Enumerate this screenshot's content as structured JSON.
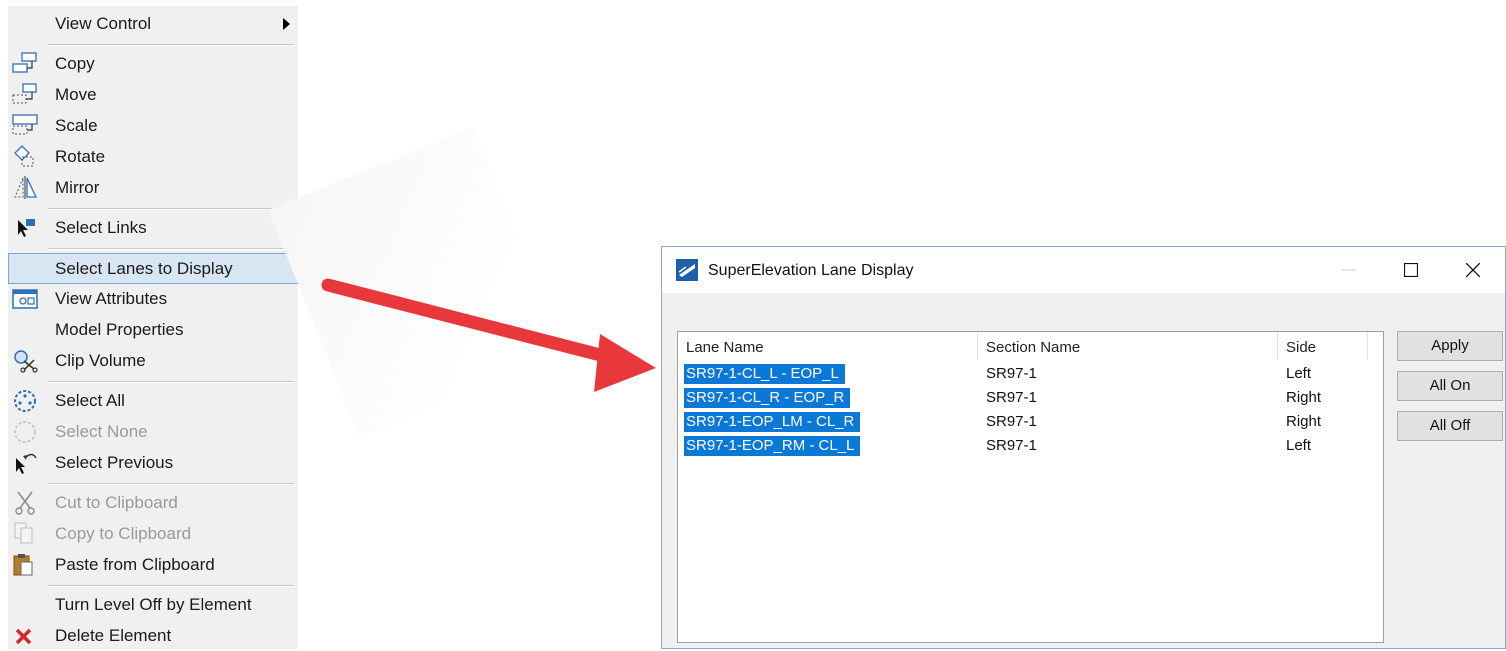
{
  "context_menu": {
    "items": [
      {
        "label": "View Control",
        "icon": "none",
        "submenu": true,
        "disabled": false
      },
      {
        "label": "Copy",
        "icon": "copy-icon",
        "submenu": false,
        "disabled": false
      },
      {
        "label": "Move",
        "icon": "move-icon",
        "submenu": false,
        "disabled": false
      },
      {
        "label": "Scale",
        "icon": "scale-icon",
        "submenu": false,
        "disabled": false
      },
      {
        "label": "Rotate",
        "icon": "rotate-icon",
        "submenu": false,
        "disabled": false
      },
      {
        "label": "Mirror",
        "icon": "mirror-icon",
        "submenu": false,
        "disabled": false
      },
      {
        "label": "Select Links",
        "icon": "select-links-icon",
        "submenu": true,
        "disabled": false
      },
      {
        "label": "Select Lanes to Display",
        "icon": "none",
        "submenu": false,
        "disabled": false,
        "highlighted": true
      },
      {
        "label": "View Attributes",
        "icon": "view-attributes-icon",
        "submenu": false,
        "disabled": false
      },
      {
        "label": "Model Properties",
        "icon": "none",
        "submenu": false,
        "disabled": false
      },
      {
        "label": "Clip Volume",
        "icon": "clip-volume-icon",
        "submenu": false,
        "disabled": false
      },
      {
        "label": "Select All",
        "icon": "select-all-icon",
        "submenu": false,
        "disabled": false
      },
      {
        "label": "Select None",
        "icon": "select-none-icon",
        "submenu": false,
        "disabled": true
      },
      {
        "label": "Select Previous",
        "icon": "select-previous-icon",
        "submenu": false,
        "disabled": false
      },
      {
        "label": "Cut to Clipboard",
        "icon": "scissors-icon",
        "submenu": false,
        "disabled": true
      },
      {
        "label": "Copy to Clipboard",
        "icon": "copy-clipboard-icon",
        "submenu": false,
        "disabled": true
      },
      {
        "label": "Paste from Clipboard",
        "icon": "paste-icon",
        "submenu": false,
        "disabled": false
      },
      {
        "label": "Turn Level Off by Element",
        "icon": "none",
        "submenu": false,
        "disabled": false
      },
      {
        "label": "Delete Element",
        "icon": "delete-x-icon",
        "submenu": false,
        "disabled": false
      }
    ]
  },
  "arrow": {
    "color": "#e8383b",
    "icon": "arrow-icon"
  },
  "dialog": {
    "title": "SuperElevation Lane Display",
    "icon": "superelevation-app-icon",
    "columns": [
      "Lane Name",
      "Section Name",
      "Side"
    ],
    "rows": [
      {
        "lane": "SR97-1-CL_L - EOP_L",
        "section": "SR97-1",
        "side": "Left",
        "selected": true
      },
      {
        "lane": "SR97-1-CL_R - EOP_R",
        "section": "SR97-1",
        "side": "Right",
        "selected": true
      },
      {
        "lane": "SR97-1-EOP_LM - CL_R",
        "section": "SR97-1",
        "side": "Right",
        "selected": true
      },
      {
        "lane": "SR97-1-EOP_RM - CL_L",
        "section": "SR97-1",
        "side": "Left",
        "selected": true
      }
    ],
    "buttons": {
      "apply": "Apply",
      "all_on": "All On",
      "all_off": "All Off"
    },
    "selection_color": "#0a78d7"
  }
}
